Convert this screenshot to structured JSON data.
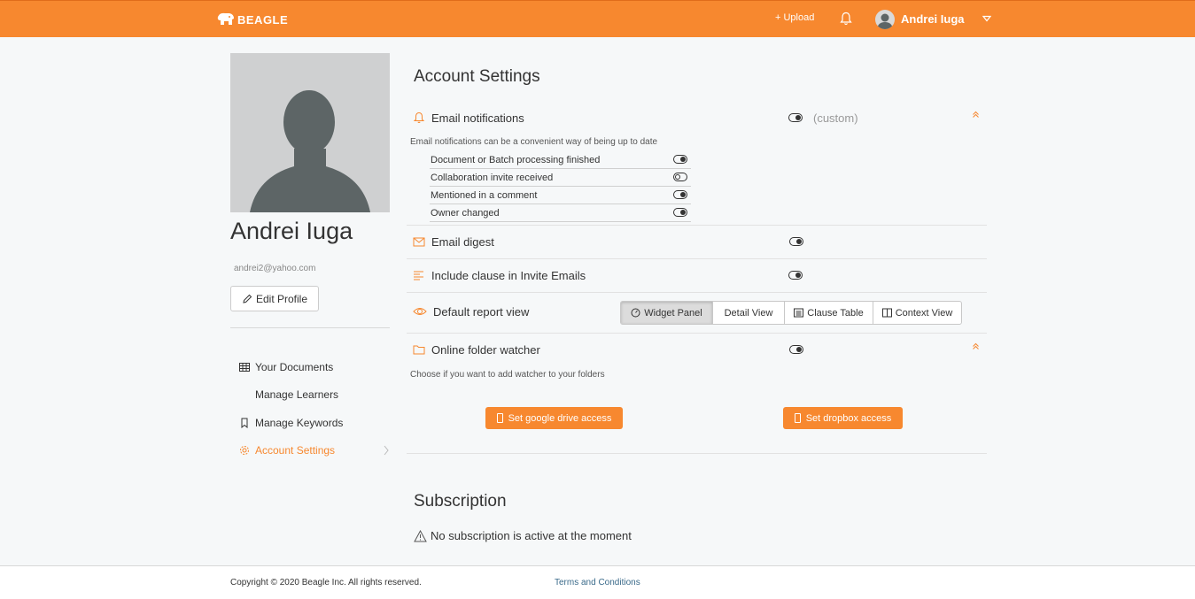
{
  "header": {
    "brand": "BEAGLE",
    "upload_label": "+ Upload",
    "user_name": "Andrei Iuga"
  },
  "profile": {
    "name": "Andrei Iuga",
    "email": "andrei2@yahoo.com",
    "edit_label": "Edit Profile"
  },
  "nav": {
    "items": [
      {
        "label": "Your Documents",
        "icon": "table-icon",
        "active": false
      },
      {
        "label": "Manage Learners",
        "icon": "",
        "active": false
      },
      {
        "label": "Manage Keywords",
        "icon": "bookmark-icon",
        "active": false
      },
      {
        "label": "Account Settings",
        "icon": "gear-icon",
        "active": true
      }
    ]
  },
  "account": {
    "title": "Account Settings",
    "email_notifications": {
      "label": "Email notifications",
      "state": "on",
      "custom_label": "(custom)",
      "description": "Email notifications can be a convenient way of being up to date",
      "items": [
        {
          "label": "Document or Batch processing finished",
          "state": "on"
        },
        {
          "label": "Collaboration invite received",
          "state": "off"
        },
        {
          "label": "Mentioned in a comment",
          "state": "on"
        },
        {
          "label": "Owner changed",
          "state": "on"
        }
      ]
    },
    "email_digest": {
      "label": "Email digest",
      "state": "on"
    },
    "include_clause": {
      "label": "Include clause in Invite Emails",
      "state": "on"
    },
    "default_report_view": {
      "label": "Default report view",
      "options": [
        "Widget Panel",
        "Detail View",
        "Clause Table",
        "Context View"
      ],
      "selected": "Widget Panel"
    },
    "folder_watcher": {
      "label": "Online folder watcher",
      "state": "on",
      "description": "Choose if you want to add watcher to your folders",
      "google_label": "Set google drive access",
      "dropbox_label": "Set dropbox access"
    }
  },
  "subscription": {
    "title": "Subscription",
    "message": "No subscription is active at the moment"
  },
  "footer": {
    "copyright": "Copyright © 2020 Beagle Inc. All rights reserved.",
    "terms": "Terms and Conditions"
  },
  "colors": {
    "brand": "#f7882f",
    "active_nav": "#f7882f"
  }
}
